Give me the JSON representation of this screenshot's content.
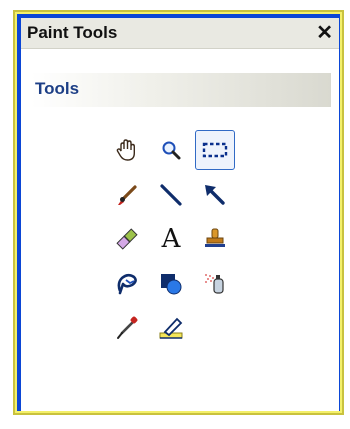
{
  "window": {
    "title": "Paint Tools",
    "close_glyph": "✕"
  },
  "section": {
    "title": "Tools"
  },
  "tools": {
    "hand": "hand-icon",
    "zoom": "magnifier-icon",
    "rect_select": "rectangle-select-icon",
    "brush": "brush-icon",
    "line": "line-icon",
    "arrow": "arrow-icon",
    "eraser": "eraser-icon",
    "text": "text-icon",
    "text_glyph": "A",
    "stamp": "stamp-icon",
    "lasso": "lasso-icon",
    "shapes": "shapes-icon",
    "spray": "spray-icon",
    "eyedropper": "eyedropper-icon",
    "highlighter": "highlighter-icon"
  },
  "selected_tool": "rect_select"
}
